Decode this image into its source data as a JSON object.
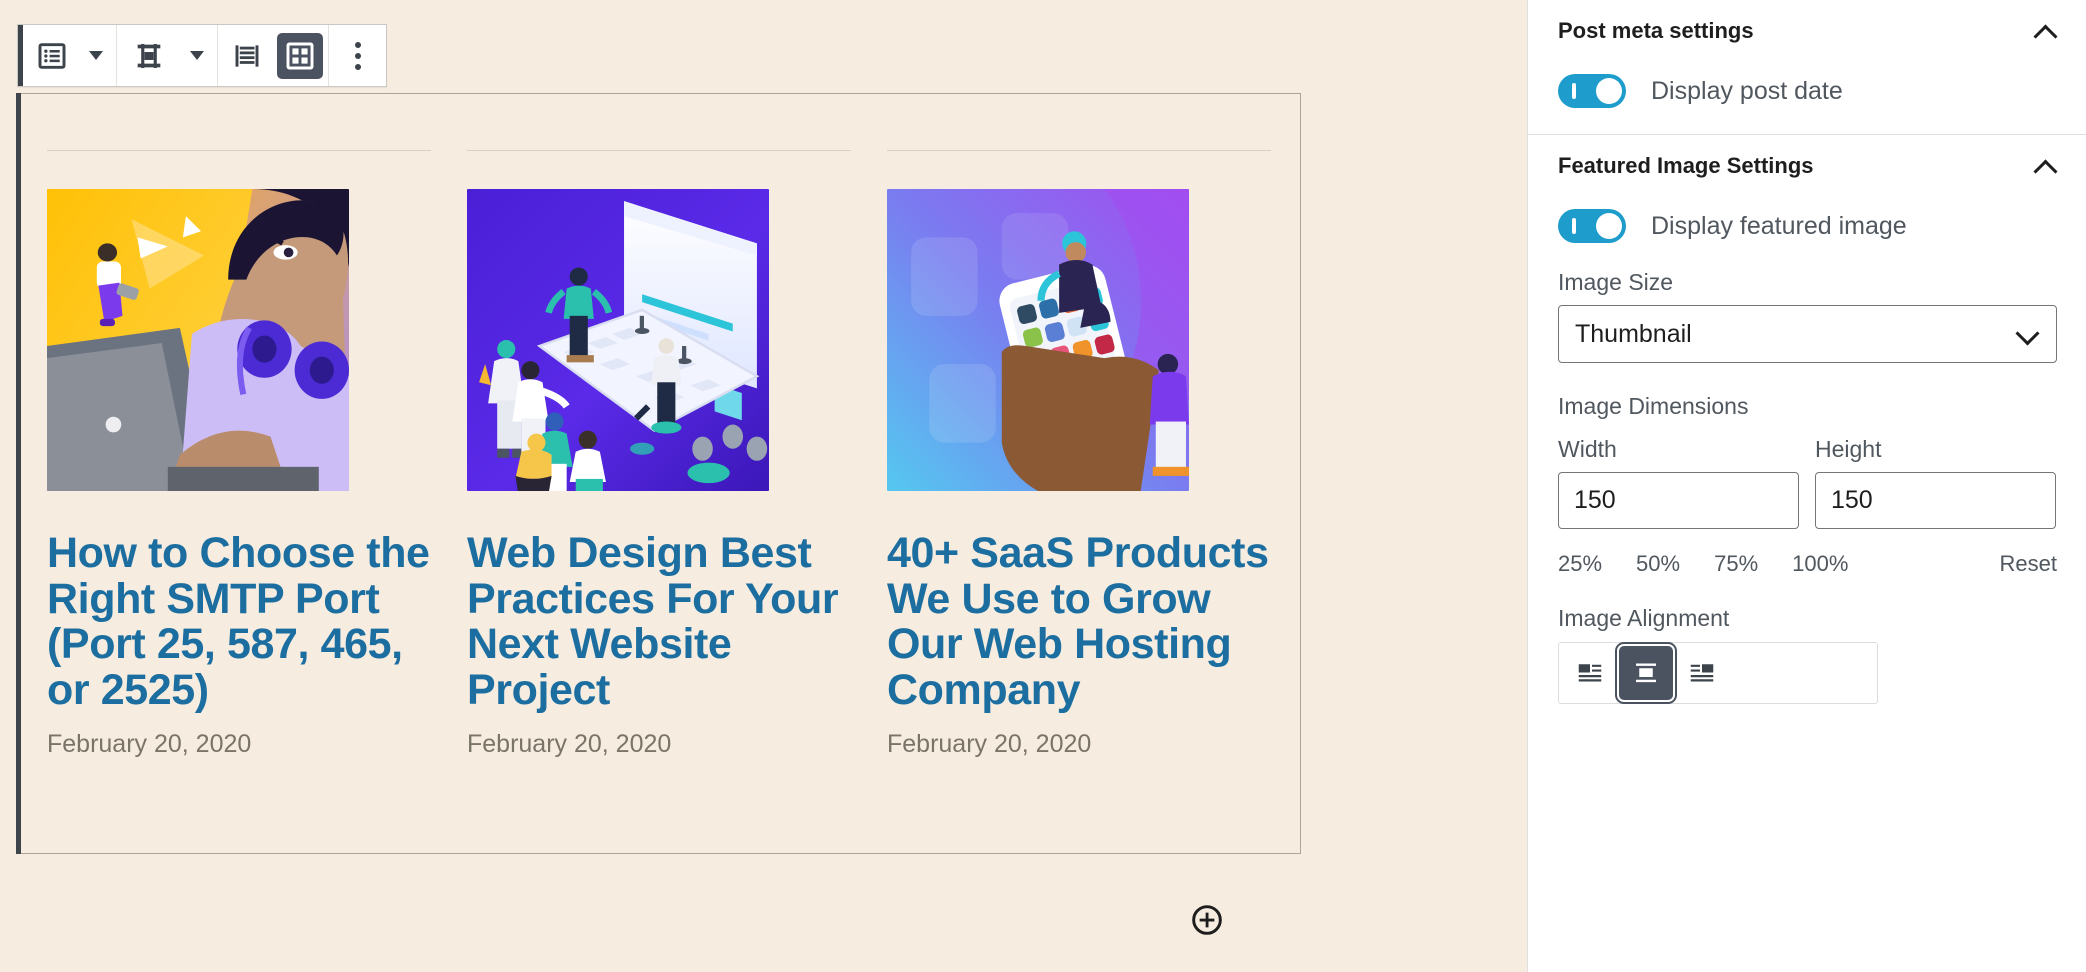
{
  "editor": {
    "toolbar": {
      "items": [
        {
          "name": "change-block-type",
          "icon": "list-view-icon",
          "label": "Change block type or style"
        },
        {
          "name": "block-type-dropdown",
          "icon": "chevron-down-icon",
          "label": "Block type options"
        },
        {
          "name": "change-alignment",
          "icon": "align-center-icon",
          "label": "Change alignment"
        },
        {
          "name": "alignment-dropdown",
          "icon": "chevron-down-icon",
          "label": "Alignment options"
        },
        {
          "name": "list-view-layout",
          "icon": "list-layout-icon",
          "label": "List view"
        },
        {
          "name": "grid-view-layout",
          "icon": "grid-layout-icon",
          "label": "Grid view"
        },
        {
          "name": "more-options",
          "icon": "vertical-dots-icon",
          "label": "More options"
        }
      ],
      "selected_layout": "grid-view-layout"
    },
    "add_block_button": {
      "icon": "plus-circle-icon",
      "label": "Add block"
    },
    "posts": [
      {
        "title": "How to Choose the Right SMTP Port (Port 25, 587, 465, or 2525)",
        "date": "February 20, 2020",
        "thumbnail_alt": "Illustration of a person with purple headphones working at a laptop on an orange background"
      },
      {
        "title": "Web Design Best Practices For Your Next Website Project",
        "date": "February 20, 2020",
        "thumbnail_alt": "Isometric illustration of people around a large laptop on a purple background"
      },
      {
        "title": "40+ SaaS Products We Use to Grow Our Web Hosting Company",
        "date": "February 20, 2020",
        "thumbnail_alt": "Illustration of a hand holding a smartphone with colorful app icons on a blue purple background"
      }
    ]
  },
  "sidebar": {
    "post_meta": {
      "title": "Post meta settings",
      "collapse_icon": "chevron-up-icon",
      "display_post_date": {
        "label": "Display post date",
        "enabled": true
      }
    },
    "featured_image": {
      "title": "Featured Image Settings",
      "collapse_icon": "chevron-up-icon",
      "display_featured_image": {
        "label": "Display featured image",
        "enabled": true
      },
      "image_size": {
        "label": "Image Size",
        "value": "Thumbnail",
        "icon": "chevron-down-icon"
      },
      "image_dimensions": {
        "label": "Image Dimensions",
        "width": {
          "label": "Width",
          "value": "150"
        },
        "height": {
          "label": "Height",
          "value": "150"
        },
        "scale_options": [
          "25%",
          "50%",
          "75%",
          "100%"
        ],
        "reset_label": "Reset"
      },
      "image_alignment": {
        "label": "Image Alignment",
        "options": [
          {
            "name": "align-left",
            "icon": "align-left-icon"
          },
          {
            "name": "align-center",
            "icon": "align-center-icon"
          },
          {
            "name": "align-right",
            "icon": "align-right-icon"
          }
        ],
        "selected": "align-center"
      }
    }
  },
  "colors": {
    "canvas_bg": "#f6ece0",
    "link_blue": "#1b6e9f",
    "toggle_on": "#1e9ccb",
    "toolbar_dark": "#4b5361",
    "date_gray": "#7b7468"
  }
}
